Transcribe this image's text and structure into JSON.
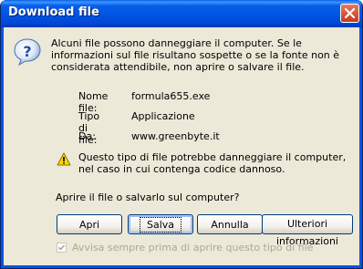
{
  "window": {
    "title": "Download file"
  },
  "message": "Alcuni file possono danneggiare il computer. Se le informazioni sul file risultano sospette o se la fonte non è considerata attendibile, non aprire o salvare il file.",
  "file_info": {
    "name_label": "Nome file:",
    "name_value": "formula655.exe",
    "type_label": "Tipo di file:",
    "type_value": "Applicazione",
    "from_label": "Da:",
    "from_value": "www.greenbyte.it"
  },
  "warning": "Questo tipo di file potrebbe danneggiare il computer, nel caso in cui contenga codice dannoso.",
  "question": "Aprire il file o salvarlo sul computer?",
  "buttons": {
    "open": "Apri",
    "save": "Salva",
    "cancel": "Annulla",
    "more_info": "Ulteriori informazioni"
  },
  "checkbox": {
    "label": "Avvisa sempre prima di aprire questo tipo di file",
    "checked": true
  },
  "icons": {
    "question": "question-icon",
    "warning": "warning-icon",
    "close": "close-icon"
  }
}
